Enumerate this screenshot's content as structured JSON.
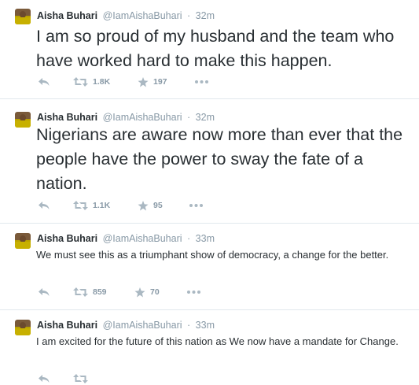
{
  "tweets": [
    {
      "name": "Aisha Buhari",
      "handle": "@IamAishaBuhari",
      "separator": "·",
      "time": "32m",
      "text": "I am so proud of my husband and the team who have worked hard to make this happen.",
      "retweets": "1.8K",
      "favorites": "197"
    },
    {
      "name": "Aisha Buhari",
      "handle": "@IamAishaBuhari",
      "separator": "·",
      "time": "32m",
      "text": "Nigerians are aware now more than ever that the people have the power to sway the fate of a nation.",
      "retweets": "1.1K",
      "favorites": "95"
    },
    {
      "name": "Aisha Buhari",
      "handle": "@IamAishaBuhari",
      "separator": "·",
      "time": "33m",
      "text": "We must see this as a triumphant show of democracy, a change for the better.",
      "retweets": "859",
      "favorites": "70"
    },
    {
      "name": "Aisha Buhari",
      "handle": "@IamAishaBuhari",
      "separator": "·",
      "time": "33m",
      "text": "I am excited for the future of this nation as We now have a mandate for Change.",
      "retweets": "",
      "favorites": ""
    }
  ],
  "colors": {
    "secondary": "#8899a6",
    "text": "#292f33",
    "divider": "#e1e8ed"
  },
  "icons": {
    "reply": "reply-icon",
    "retweet": "retweet-icon",
    "favorite": "star-icon",
    "more": "more-icon"
  }
}
